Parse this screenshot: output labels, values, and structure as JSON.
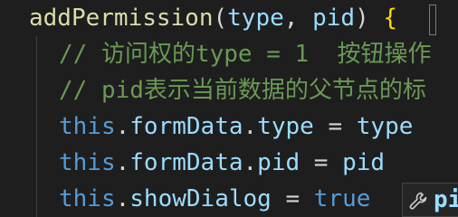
{
  "code": {
    "line1": {
      "fn": "addPermission",
      "open_paren": "(",
      "param1": "type",
      "comma": ", ",
      "param2": "pid",
      "close_paren": ") ",
      "brace": "{"
    },
    "line2": {
      "comment": "// 访问权的type = 1  按钮操作"
    },
    "line3": {
      "comment": "// pid表示当前数据的父节点的标"
    },
    "line4": {
      "this": "this",
      "dot1": ".",
      "prop1": "formData",
      "dot2": ".",
      "prop2": "type",
      "op": " = ",
      "value": "type"
    },
    "line5": {
      "this": "this",
      "dot1": ".",
      "prop1": "formData",
      "dot2": ".",
      "prop2": "pid",
      "op": " = ",
      "value": "pid"
    },
    "line6": {
      "this": "this",
      "dot1": ".",
      "prop1": "showDialog",
      "op": " = ",
      "value": "true"
    }
  },
  "hint": {
    "icon": "wrench-icon",
    "text": "pi"
  },
  "colors": {
    "background": "#1e1e1e",
    "function": "#dcdcaa",
    "parameter": "#9cdcfe",
    "comment": "#6a9955",
    "keyword": "#569cd6",
    "brace": "#ffd700"
  }
}
